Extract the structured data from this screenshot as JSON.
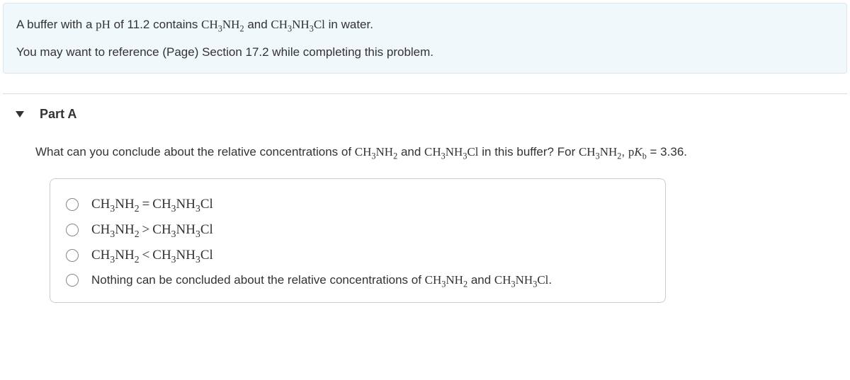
{
  "intro": {
    "line1_pre": "A buffer with a ",
    "pH_label": "pH",
    "line1_mid1": " of 11.2 contains ",
    "species1": "CH3NH2",
    "line1_mid2": " and ",
    "species2": "CH3NH3Cl",
    "line1_post": " in water.",
    "line2": "You may want to reference (Page) Section 17.2 while completing this problem."
  },
  "part": {
    "title": "Part A",
    "question_pre": "What can you conclude about the relative concentrations of ",
    "q_species1": "CH3NH2",
    "q_mid1": " and ",
    "q_species2": "CH3NH3Cl",
    "q_mid2": " in this buffer? For ",
    "q_species3": "CH3NH2",
    "q_mid3": ", ",
    "pkb_label": "pKb",
    "q_eq": " = 3.36."
  },
  "options": [
    {
      "type": "eq",
      "left": "CH3NH2",
      "sym": "=",
      "right": "CH3NH3Cl"
    },
    {
      "type": "gt",
      "left": "CH3NH2",
      "sym": ">",
      "right": "CH3NH3Cl"
    },
    {
      "type": "lt",
      "left": "CH3NH2",
      "sym": "<",
      "right": "CH3NH3Cl"
    },
    {
      "type": "text",
      "pre": "Nothing can be concluded about the relative concentrations of ",
      "s1": "CH3NH2",
      "mid": " and ",
      "s2": "CH3NH3Cl",
      "post": "."
    }
  ]
}
